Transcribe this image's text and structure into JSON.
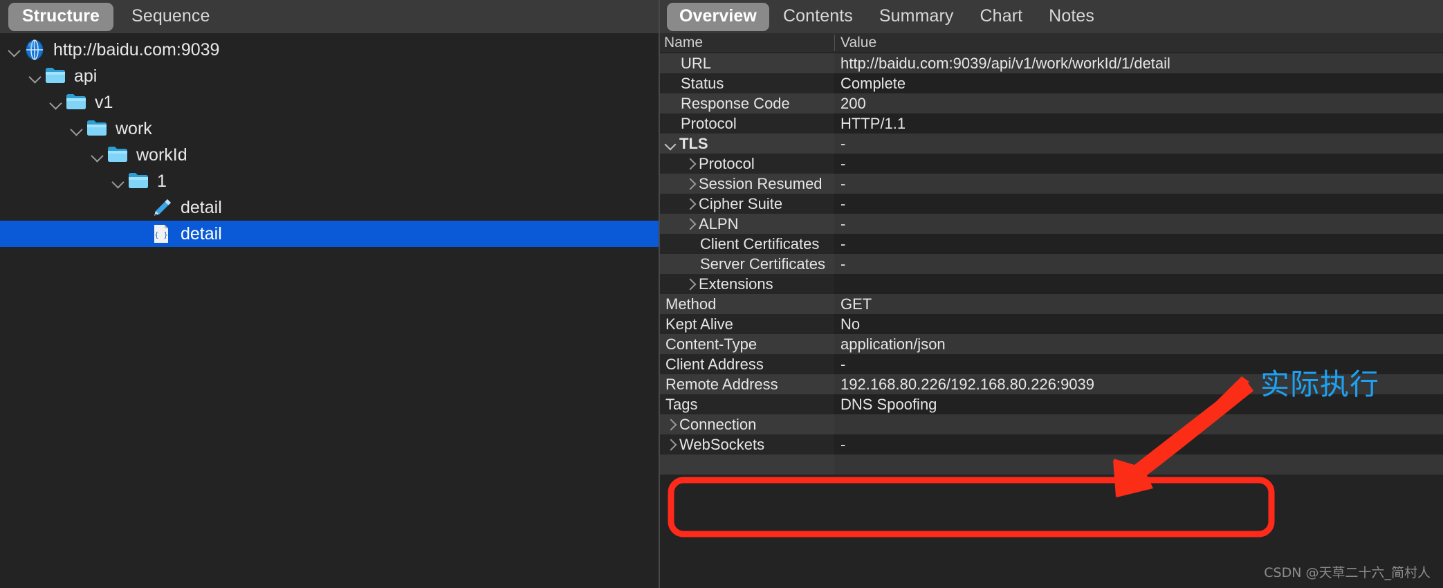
{
  "left_panel": {
    "tabs": [
      {
        "label": "Structure",
        "active": true
      },
      {
        "label": "Sequence",
        "active": false
      }
    ],
    "tree": [
      {
        "label": "http://baidu.com:9039",
        "depth": 0,
        "icon": "globe-icon",
        "expanded": true,
        "selected": false
      },
      {
        "label": "api",
        "depth": 1,
        "icon": "folder-icon",
        "expanded": true,
        "selected": false
      },
      {
        "label": "v1",
        "depth": 2,
        "icon": "folder-icon",
        "expanded": true,
        "selected": false
      },
      {
        "label": "work",
        "depth": 3,
        "icon": "folder-icon",
        "expanded": true,
        "selected": false
      },
      {
        "label": "workId",
        "depth": 4,
        "icon": "folder-icon",
        "expanded": true,
        "selected": false
      },
      {
        "label": "1",
        "depth": 5,
        "icon": "folder-icon",
        "expanded": true,
        "selected": false
      },
      {
        "label": "detail",
        "depth": 6,
        "icon": "pen-icon",
        "expanded": false,
        "selected": false
      },
      {
        "label": "detail",
        "depth": 6,
        "icon": "json-document-icon",
        "expanded": false,
        "selected": true
      }
    ]
  },
  "right_panel": {
    "tabs": [
      {
        "label": "Overview",
        "active": true
      },
      {
        "label": "Contents",
        "active": false
      },
      {
        "label": "Summary",
        "active": false
      },
      {
        "label": "Chart",
        "active": false
      },
      {
        "label": "Notes",
        "active": false
      }
    ],
    "columns": {
      "name": "Name",
      "value": "Value"
    },
    "rows": [
      {
        "name": "URL",
        "value": "http://baidu.com:9039/api/v1/work/workId/1/detail",
        "indent": 1,
        "disclosure": "none",
        "bold": false
      },
      {
        "name": "Status",
        "value": "Complete",
        "indent": 1,
        "disclosure": "none",
        "bold": false
      },
      {
        "name": "Response Code",
        "value": "200",
        "indent": 1,
        "disclosure": "none",
        "bold": false
      },
      {
        "name": "Protocol",
        "value": "HTTP/1.1",
        "indent": 1,
        "disclosure": "none",
        "bold": false
      },
      {
        "name": "TLS",
        "value": "-",
        "indent": 0,
        "disclosure": "open",
        "bold": true
      },
      {
        "name": "Protocol",
        "value": "-",
        "indent": 1,
        "disclosure": "closed",
        "bold": false
      },
      {
        "name": "Session Resumed",
        "value": "-",
        "indent": 1,
        "disclosure": "closed",
        "bold": false
      },
      {
        "name": "Cipher Suite",
        "value": "-",
        "indent": 1,
        "disclosure": "closed",
        "bold": false
      },
      {
        "name": "ALPN",
        "value": "-",
        "indent": 1,
        "disclosure": "closed",
        "bold": false
      },
      {
        "name": "Client Certificates",
        "value": "-",
        "indent": 1,
        "disclosure": "none",
        "bold": false
      },
      {
        "name": "Server Certificates",
        "value": "-",
        "indent": 1,
        "disclosure": "none",
        "bold": false
      },
      {
        "name": "Extensions",
        "value": "",
        "indent": 1,
        "disclosure": "closed",
        "bold": false
      },
      {
        "name": "Method",
        "value": "GET",
        "indent": 0,
        "disclosure": "none",
        "bold": false
      },
      {
        "name": "Kept Alive",
        "value": "No",
        "indent": 0,
        "disclosure": "none",
        "bold": false
      },
      {
        "name": "Content-Type",
        "value": "application/json",
        "indent": 0,
        "disclosure": "none",
        "bold": false
      },
      {
        "name": "Client Address",
        "value": "-",
        "indent": 0,
        "disclosure": "none",
        "bold": false
      },
      {
        "name": "Remote Address",
        "value": "192.168.80.226/192.168.80.226:9039",
        "indent": 0,
        "disclosure": "none",
        "bold": false
      },
      {
        "name": "Tags",
        "value": "DNS Spoofing",
        "indent": 0,
        "disclosure": "none",
        "bold": false
      },
      {
        "name": "Connection",
        "value": "",
        "indent": 0,
        "disclosure": "closed",
        "bold": false
      },
      {
        "name": "WebSockets",
        "value": "-",
        "indent": 0,
        "disclosure": "closed",
        "bold": false
      }
    ]
  },
  "annotations": {
    "callout_text": "实际执行",
    "callout_color": "#1ca2f5",
    "highlight_color": "#ff2a1a",
    "arrow_color": "#fb2d17"
  },
  "watermark": {
    "text": "CSDN @天草二十六_简村人"
  }
}
